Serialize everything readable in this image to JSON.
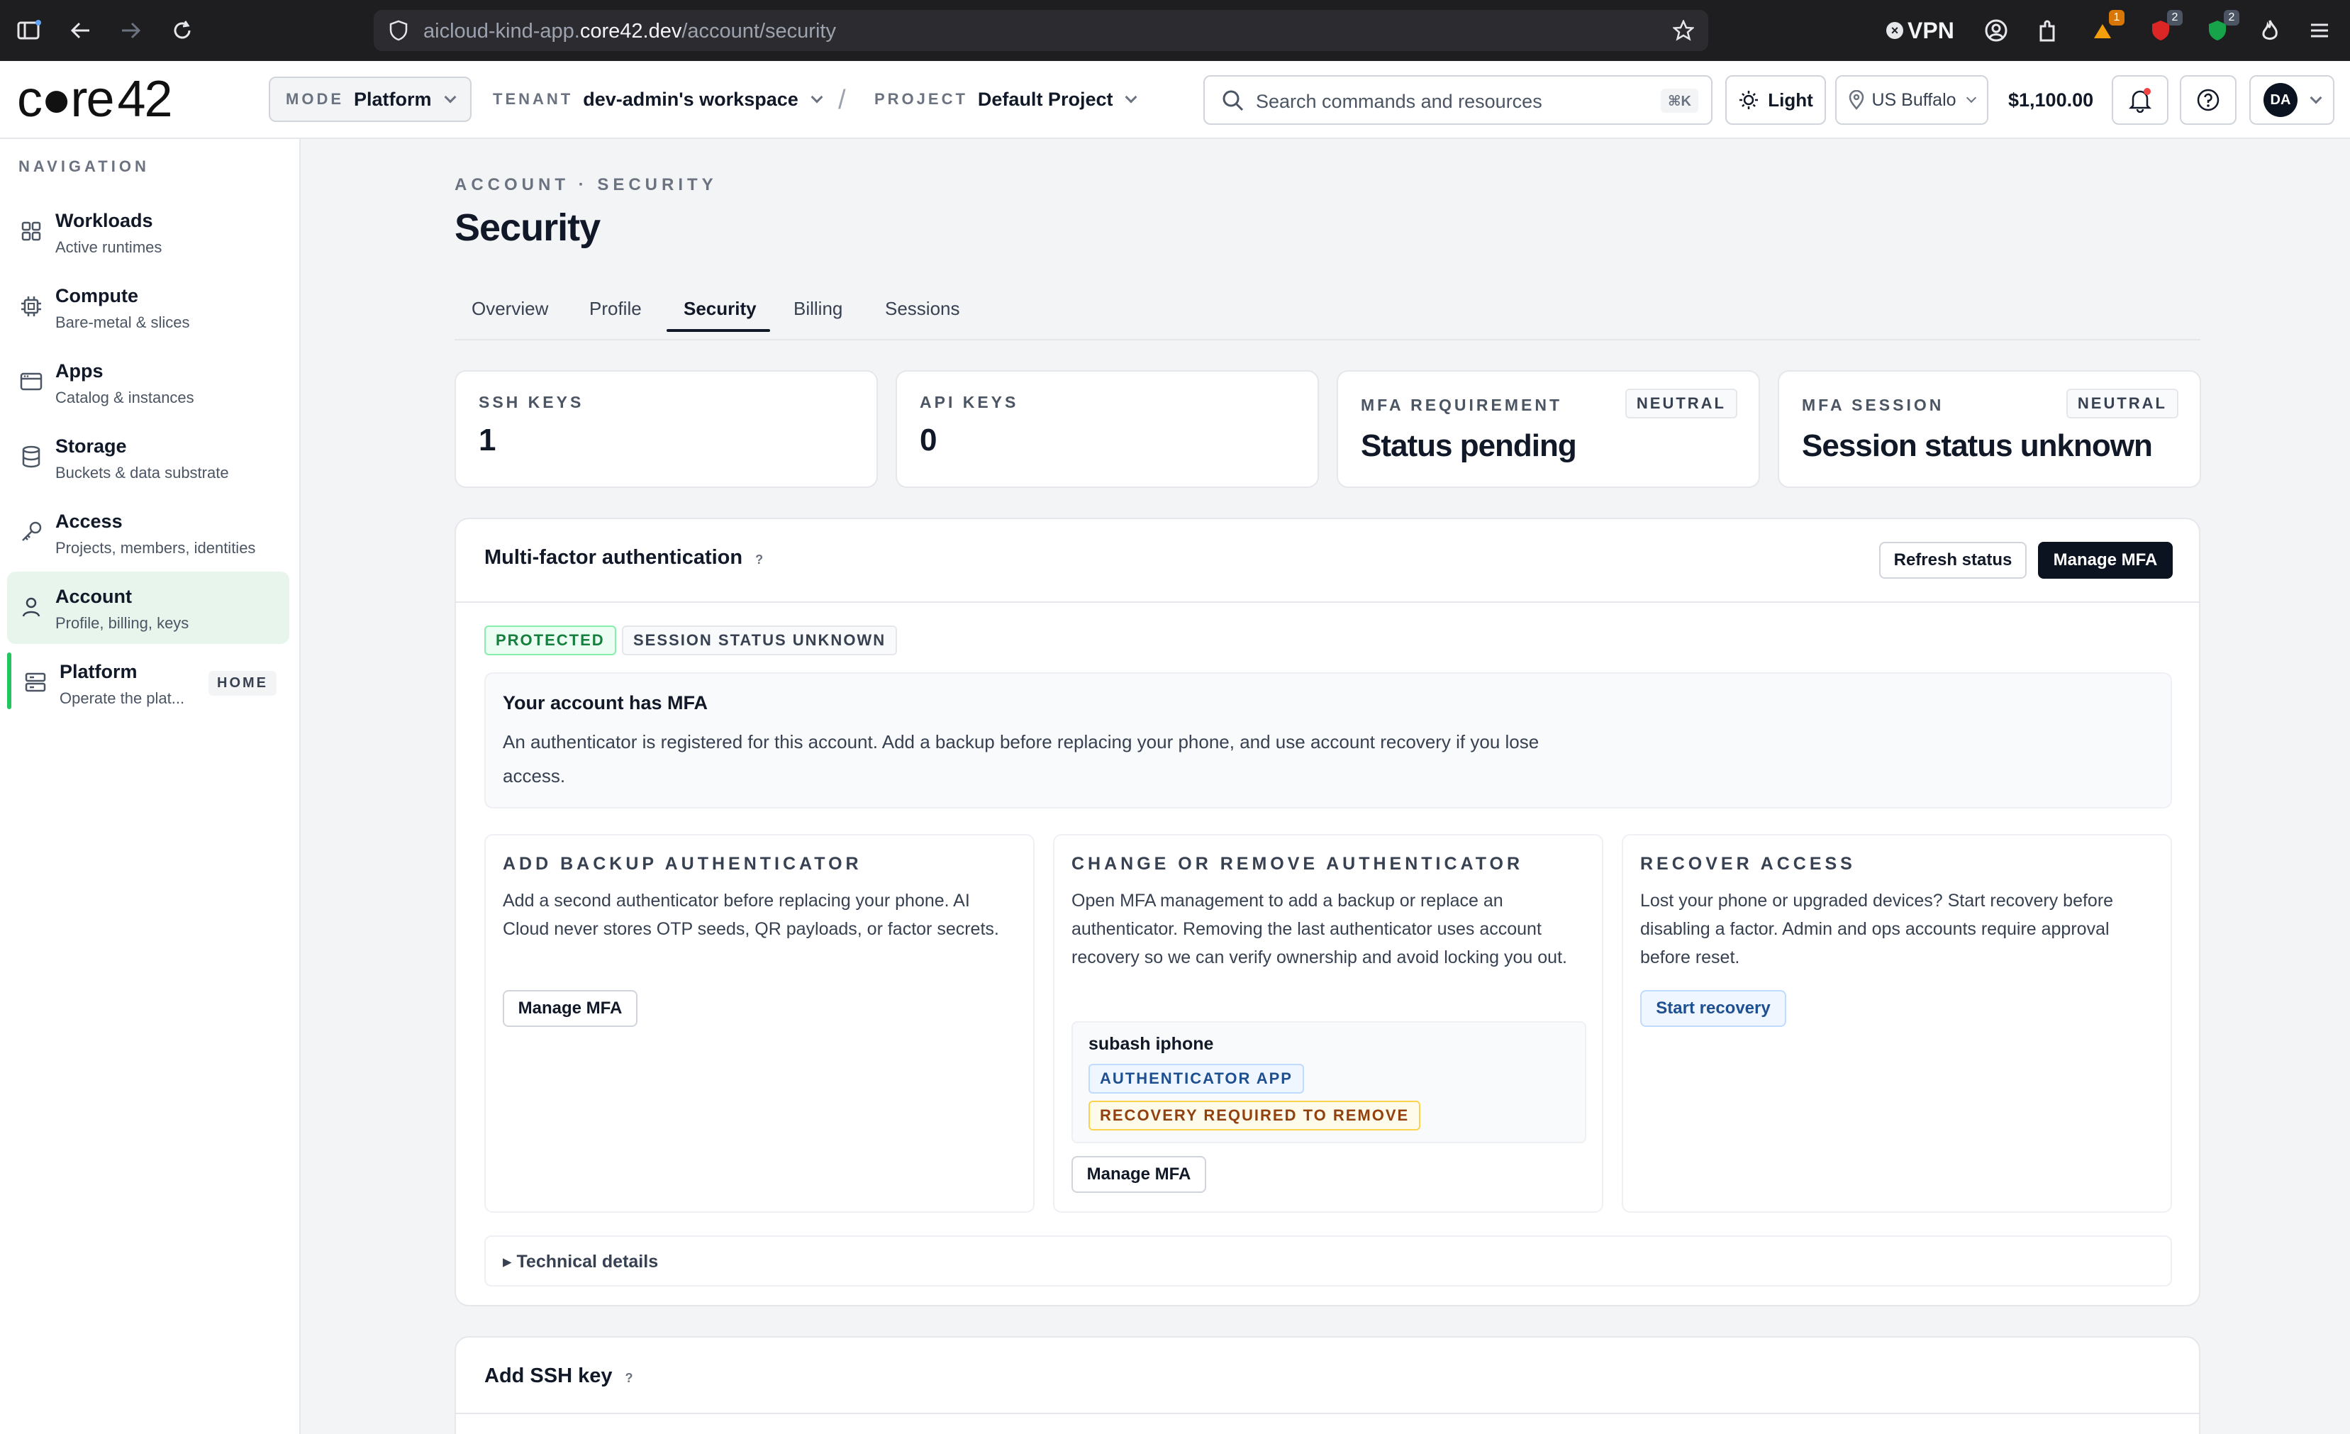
{
  "browser": {
    "url_prefix": "aicloud-kind-app.",
    "url_host": "core42.dev",
    "url_path": "/account/security",
    "vpn_label": "VPN",
    "ext_badge_1": "1",
    "ext_badge_2": "2",
    "ext_badge_3": "2"
  },
  "header": {
    "logo": "c●re",
    "logo_num": "42",
    "mode_kicker": "MODE",
    "mode_value": "Platform",
    "tenant_kicker": "TENANT",
    "tenant_value": "dev-admin's workspace",
    "slash": "/",
    "project_kicker": "PROJECT",
    "project_value": "Default Project",
    "search_placeholder": "Search commands and resources",
    "search_shortcut": "⌘K",
    "theme_label": "Light",
    "region_label": "US Buffalo",
    "credits": "$1,100.00",
    "avatar_initials": "DA"
  },
  "sidebar": {
    "kicker": "NAVIGATION",
    "items": [
      {
        "title": "Workloads",
        "sub": "Active runtimes",
        "icon": "grid-icon"
      },
      {
        "title": "Compute",
        "sub": "Bare-metal & slices",
        "icon": "chip-icon"
      },
      {
        "title": "Apps",
        "sub": "Catalog & instances",
        "icon": "window-icon"
      },
      {
        "title": "Storage",
        "sub": "Buckets & data substrate",
        "icon": "database-icon"
      },
      {
        "title": "Access",
        "sub": "Projects, members, identities",
        "icon": "key-icon"
      },
      {
        "title": "Account",
        "sub": "Profile, billing, keys",
        "icon": "user-icon"
      },
      {
        "title": "Platform",
        "sub": "Operate the plat...",
        "icon": "server-icon",
        "badge": "HOME"
      }
    ]
  },
  "page": {
    "breadcrumb": "ACCOUNT · SECURITY",
    "title": "Security",
    "tabs": [
      "Overview",
      "Profile",
      "Security",
      "Billing",
      "Sessions"
    ]
  },
  "stats": [
    {
      "label": "SSH KEYS",
      "value": "1"
    },
    {
      "label": "API KEYS",
      "value": "0"
    },
    {
      "label": "MFA REQUIREMENT",
      "value": "Status pending",
      "badge": "NEUTRAL"
    },
    {
      "label": "MFA SESSION",
      "value": "Session status unknown",
      "badge": "NEUTRAL"
    }
  ],
  "mfa": {
    "title": "Multi-factor authentication",
    "help": "?",
    "refresh_label": "Refresh status",
    "manage_label": "Manage MFA",
    "tag_protected": "PROTECTED",
    "tag_session": "SESSION STATUS UNKNOWN",
    "box_title": "Your account has MFA",
    "box_desc": "An authenticator is registered for this account. Add a backup before replacing your phone, and use account recovery if you lose access.",
    "columns": [
      {
        "kicker": "ADD BACKUP AUTHENTICATOR",
        "desc": "Add a second authenticator before replacing your phone. AI Cloud never stores OTP seeds, QR payloads, or factor secrets.",
        "button": "Manage MFA"
      },
      {
        "kicker": "CHANGE OR REMOVE AUTHENTICATOR",
        "desc": "Open MFA management to add a backup or replace an authenticator. Removing the last authenticator uses account recovery so we can verify ownership and avoid locking you out.",
        "factor_name": "subash iphone",
        "factor_tag_1": "AUTHENTICATOR APP",
        "factor_tag_2": "RECOVERY REQUIRED TO REMOVE",
        "button": "Manage MFA"
      },
      {
        "kicker": "RECOVER ACCESS",
        "desc": "Lost your phone or upgraded devices? Start recovery before disabling a factor. Admin and ops accounts require approval before reset.",
        "button": "Start recovery"
      }
    ],
    "technical": "▸ Technical details"
  },
  "ssh": {
    "title": "Add SSH key",
    "help": "?"
  },
  "colors": {
    "accent_green": "#22c55e",
    "active_bg": "#e8f5ec",
    "dark_button": "#0b1220",
    "link_blue": "#1e4f8f"
  }
}
